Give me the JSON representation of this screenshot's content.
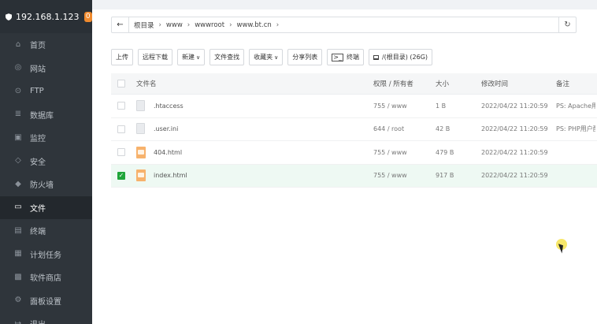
{
  "server": {
    "ip": "192.168.1.123",
    "badge": "0"
  },
  "sidebar": {
    "items": [
      {
        "label": "首页",
        "icon": "home-icon"
      },
      {
        "label": "网站",
        "icon": "globe-icon"
      },
      {
        "label": "FTP",
        "icon": "ftp-icon"
      },
      {
        "label": "数据库",
        "icon": "database-icon"
      },
      {
        "label": "监控",
        "icon": "monitor-icon"
      },
      {
        "label": "安全",
        "icon": "shield-icon"
      },
      {
        "label": "防火墙",
        "icon": "firewall-icon"
      },
      {
        "label": "文件",
        "icon": "folder-icon",
        "active": true
      },
      {
        "label": "终端",
        "icon": "terminal-icon"
      },
      {
        "label": "计划任务",
        "icon": "calendar-icon"
      },
      {
        "label": "软件商店",
        "icon": "apps-icon"
      },
      {
        "label": "面板设置",
        "icon": "settings-icon"
      },
      {
        "label": "退出",
        "icon": "logout-icon"
      }
    ]
  },
  "path": {
    "crumbs": [
      "根目录",
      "www",
      "wwwroot",
      "www.bt.cn"
    ]
  },
  "toolbar": {
    "upload": "上传",
    "remote_download": "远程下载",
    "new": "新建",
    "search": "文件查找",
    "favorites": "收藏夹",
    "share_list": "分享列表",
    "terminal": "终端",
    "disk": "/(根目录) (26G)"
  },
  "table": {
    "headers": {
      "name": "文件名",
      "perm": "权限 / 所有者",
      "size": "大小",
      "mtime": "修改时间",
      "note": "备注"
    },
    "rows": [
      {
        "name": ".htaccess",
        "perm": "755 / www",
        "size": "1 B",
        "mtime": "2022/04/22 11:20:59",
        "note": "PS: Apache用",
        "type": "doc",
        "checked": false
      },
      {
        "name": ".user.ini",
        "perm": "644 / root",
        "size": "42 B",
        "mtime": "2022/04/22 11:20:59",
        "note": "PS: PHP用户配",
        "type": "doc",
        "checked": false
      },
      {
        "name": "404.html",
        "perm": "755 / www",
        "size": "479 B",
        "mtime": "2022/04/22 11:20:59",
        "note": "",
        "type": "html",
        "checked": false
      },
      {
        "name": "index.html",
        "perm": "755 / www",
        "size": "917 B",
        "mtime": "2022/04/22 11:20:59",
        "note": "",
        "type": "html",
        "checked": true
      }
    ]
  },
  "colors": {
    "sidebar_bg": "#2f353b",
    "accent_green": "#20a53a",
    "badge_orange": "#ef8a2e"
  }
}
